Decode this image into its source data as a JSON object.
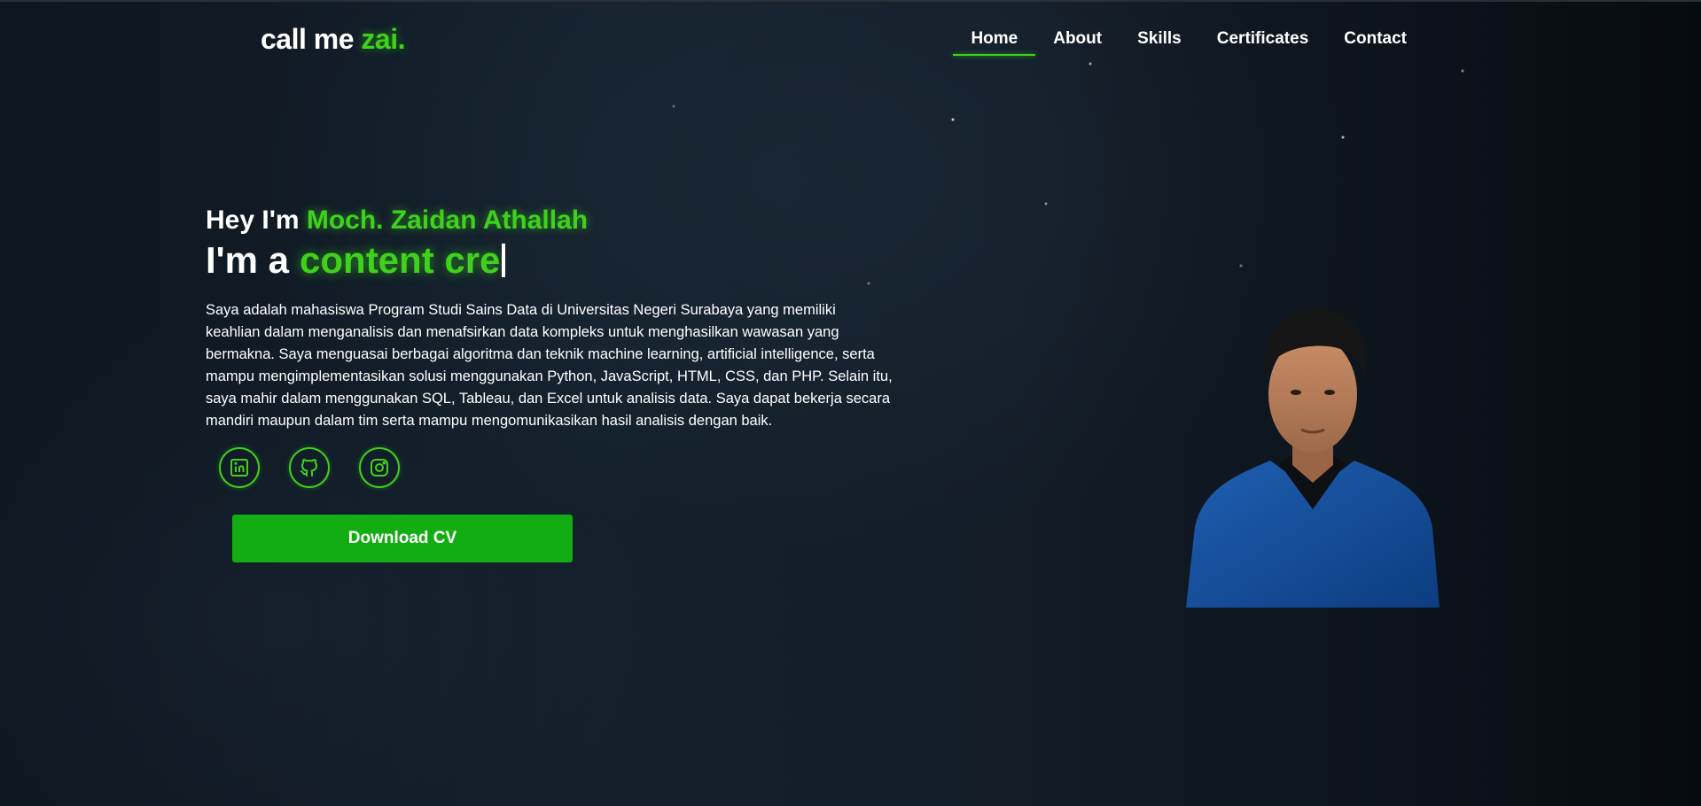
{
  "navbar": {
    "logo_main": "call me ",
    "logo_accent": "zai.",
    "links": [
      {
        "label": "Home",
        "active": true
      },
      {
        "label": "About",
        "active": false
      },
      {
        "label": "Skills",
        "active": false
      },
      {
        "label": "Certificates",
        "active": false
      },
      {
        "label": "Contact",
        "active": false
      }
    ]
  },
  "hero": {
    "greeting_prefix": "Hey I'm ",
    "name": "Moch. Zaidan Athallah",
    "role_prefix": "I'm a",
    "role_typed": "content cre",
    "bio": "Saya adalah mahasiswa Program Studi Sains Data di Universitas Negeri Surabaya yang memiliki keahlian dalam menganalisis dan menafsirkan data kompleks untuk menghasilkan wawasan yang bermakna. Saya menguasai berbagai algoritma dan teknik machine learning, artificial intelligence, serta mampu mengimplementasikan solusi menggunakan Python, JavaScript, HTML, CSS, dan PHP. Selain itu, saya mahir dalam menggunakan SQL, Tableau, dan Excel untuk analisis data. Saya dapat bekerja secara mandiri maupun dalam tim serta mampu mengomunikasikan hasil analisis dengan baik.",
    "socials": [
      {
        "icon": "linkedin-icon"
      },
      {
        "icon": "github-icon"
      },
      {
        "icon": "instagram-icon"
      }
    ],
    "download_label": "Download CV"
  },
  "colors": {
    "accent": "#3fd11c",
    "button": "#12ad12",
    "background": "#121d28"
  }
}
